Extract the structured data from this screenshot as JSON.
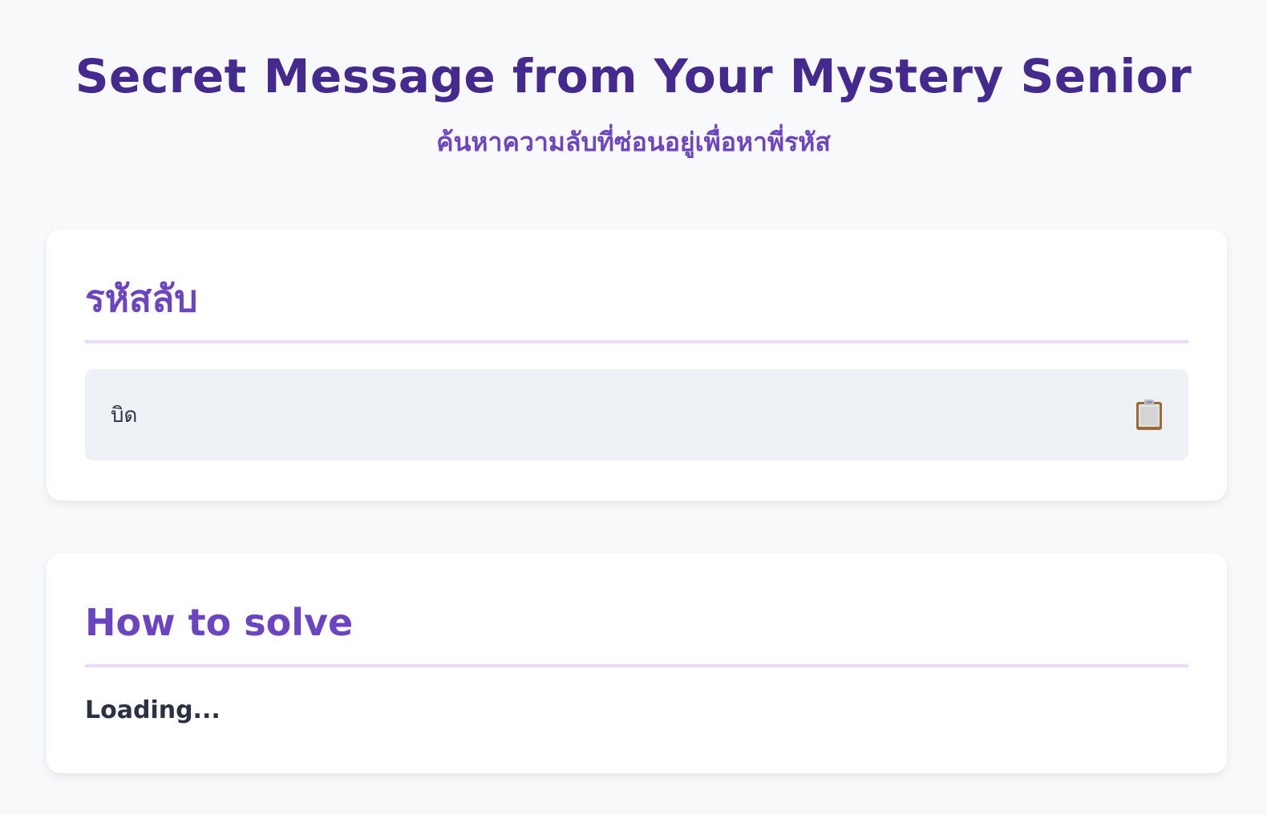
{
  "header": {
    "title": "Secret Message from Your Mystery Senior",
    "subtitle": "ค้นหาความลับที่ซ่อนอยู่เพื่อหาพี่รหัส"
  },
  "secret_card": {
    "heading": "รหัสลับ",
    "secret_text": "บิด",
    "copy_icon": "clipboard-icon"
  },
  "howto_card": {
    "heading": "How to solve",
    "body": "Loading..."
  },
  "colors": {
    "title": "#44298f",
    "accent": "#6a44c2",
    "divider": "#eadbf6",
    "page_background": "#f8f9fb",
    "secret_box_background": "#eef1f5"
  }
}
